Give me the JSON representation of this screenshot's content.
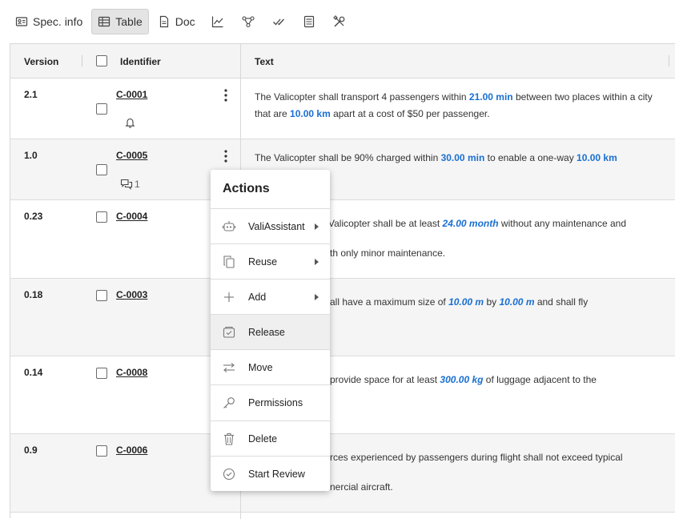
{
  "toolbar": {
    "spec_info": "Spec. info",
    "table": "Table",
    "doc": "Doc",
    "icons": [
      "chart-icon",
      "graph-icon",
      "check-icon",
      "calculator-icon",
      "tools-icon"
    ]
  },
  "table": {
    "headers": {
      "version": "Version",
      "identifier": "Identifier",
      "text": "Text"
    },
    "rows": [
      {
        "version": "2.1",
        "id": "C-0001",
        "t1": "The Valicopter shall transport 4 passengers within ",
        "v1": "21.00  min",
        "t2": " between two places within a city that are ",
        "v2": "10.00  km",
        "t3": " apart at a cost of $50 per passenger."
      },
      {
        "version": "1.0",
        "id": "C-0005",
        "comments": "1",
        "t1": "The Valicopter shall be 90% charged within ",
        "v1": "30.00  min",
        "t2": " to enable a one-way ",
        "v2": "10.00  km"
      },
      {
        "version": "0.23",
        "id": "C-0004",
        "t1": "Valicopter shall be at least ",
        "v1": "24.00  month",
        "t2": " without any maintenance and",
        "t3": "th only minor maintenance."
      },
      {
        "version": "0.18",
        "id": "C-0003",
        "t1": "all have a maximum size of ",
        "v1": "10.00  m",
        "t2": " by ",
        "v2": "10.00  m",
        "t3": " and shall fly"
      },
      {
        "version": "0.14",
        "id": "C-0008",
        "t1": "provide space for at least ",
        "v1": "300.00  kg",
        "t2": " of luggage adjacent to the"
      },
      {
        "version": "0.9",
        "id": "C-0006",
        "t1": "rces experienced by passengers during flight shall not exceed typical",
        "t3": "nercial aircraft."
      }
    ]
  },
  "menu": {
    "title": "Actions",
    "items": [
      {
        "label": "ValiAssistant",
        "icon": "robot-icon"
      },
      {
        "label": "Reuse",
        "icon": "copy-icon"
      },
      {
        "label": "Add",
        "icon": "plus-icon"
      },
      {
        "label": "Release",
        "icon": "release-icon"
      },
      {
        "label": "Move",
        "icon": "move-icon"
      },
      {
        "label": "Permissions",
        "icon": "key-icon"
      },
      {
        "label": "Delete",
        "icon": "trash-icon"
      },
      {
        "label": "Start Review",
        "icon": "review-check-icon"
      }
    ]
  },
  "colors": {
    "accent": "#1a6fd1",
    "row_alt": "#f5f5f5",
    "header_bg": "#f4f4f4"
  }
}
